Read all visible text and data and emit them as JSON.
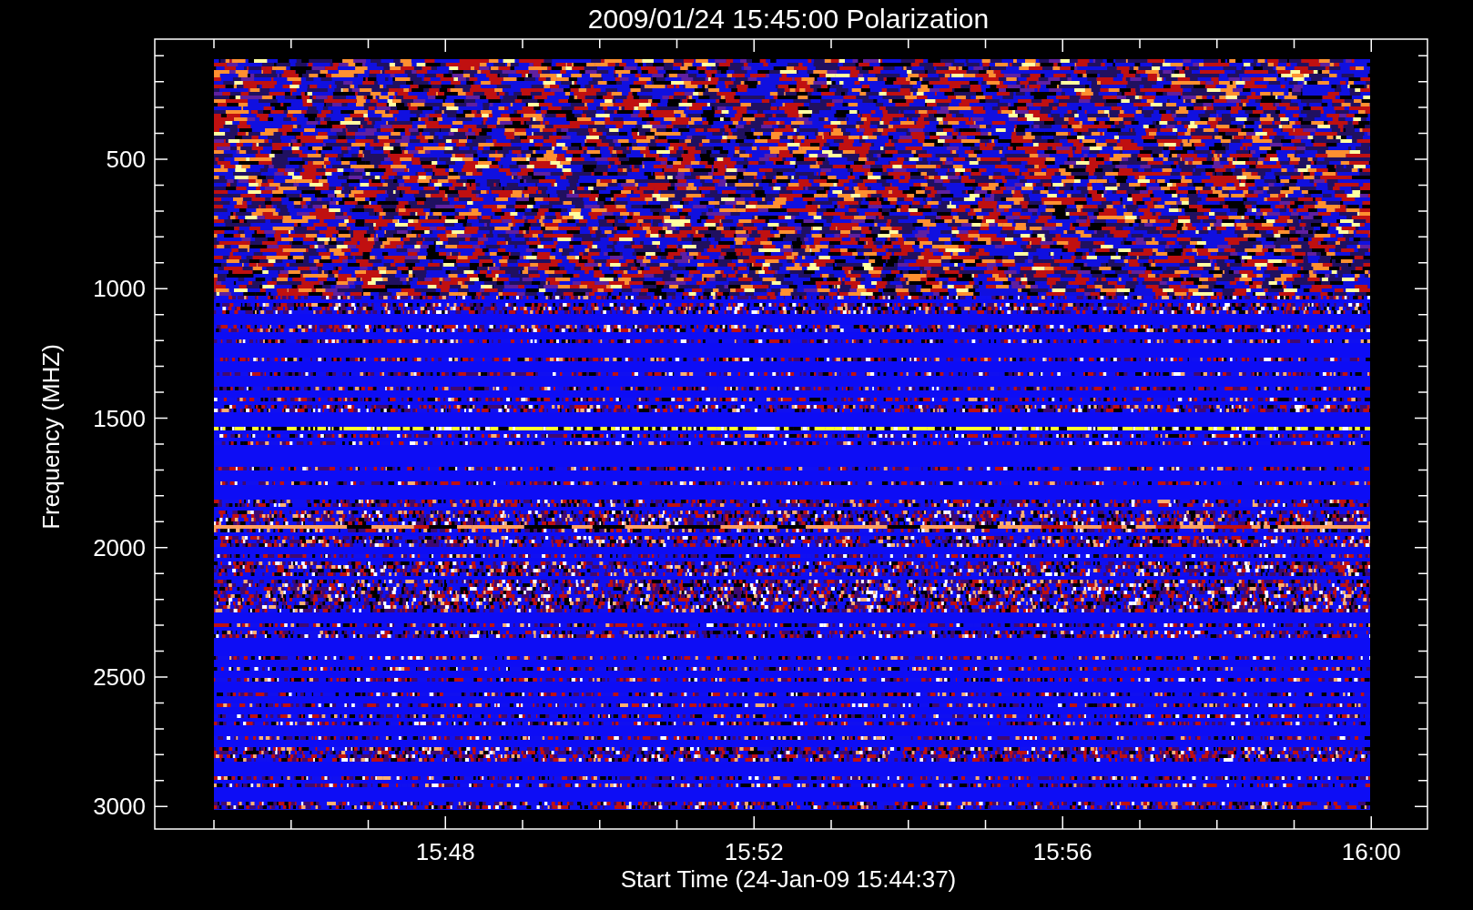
{
  "title": "2009/01/24 15:45:00 Polarization",
  "y_axis": {
    "label": "Frequency (MHZ)",
    "ticks": [
      "500",
      "1000",
      "1500",
      "2000",
      "2500",
      "3000"
    ]
  },
  "x_axis": {
    "label": "Start Time (24-Jan-09 15:44:37)",
    "ticks": [
      "15:48",
      "15:52",
      "15:56",
      "16:00"
    ]
  }
}
